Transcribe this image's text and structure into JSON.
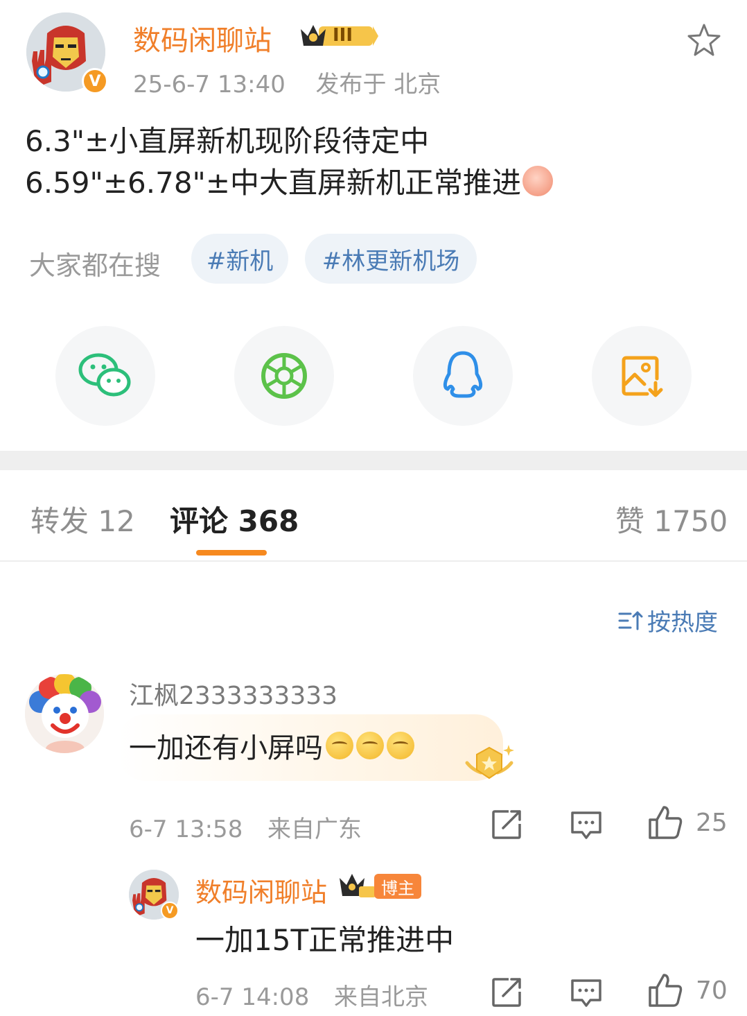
{
  "post": {
    "author": "数码闲聊站",
    "member_level": "III",
    "timestamp": "25-6-7 13:40",
    "location": "发布于 北京",
    "lines": [
      "6.3\"±小直屏新机现阶段待定中",
      "6.59\"±6.78\"±中大直屏新机正常推进"
    ],
    "search_label": "大家都在搜",
    "chips": [
      "#新机",
      "#林更新机场"
    ]
  },
  "share": {
    "icons": [
      "wechat-icon",
      "moments-icon",
      "qq-icon",
      "save-image-icon"
    ]
  },
  "tabs": {
    "repost": "转发 12",
    "comments": "评论 368",
    "likes": "赞 1750"
  },
  "sort": {
    "label": "按热度"
  },
  "comment": {
    "user": "江枫2333333333",
    "text": "一加还有小屏吗",
    "emoji_count": 3,
    "time": "6-7 13:58",
    "from": "来自广东",
    "likes": "25"
  },
  "reply": {
    "user": "数码闲聊站",
    "badge": "博主",
    "text": "一加15T正常推进中",
    "time": "6-7 14:08",
    "from": "来自北京",
    "likes": "70"
  },
  "colors": {
    "brand_orange": "#f07f2a",
    "link_blue": "#4a7bb5",
    "accent": "#f6891f"
  }
}
